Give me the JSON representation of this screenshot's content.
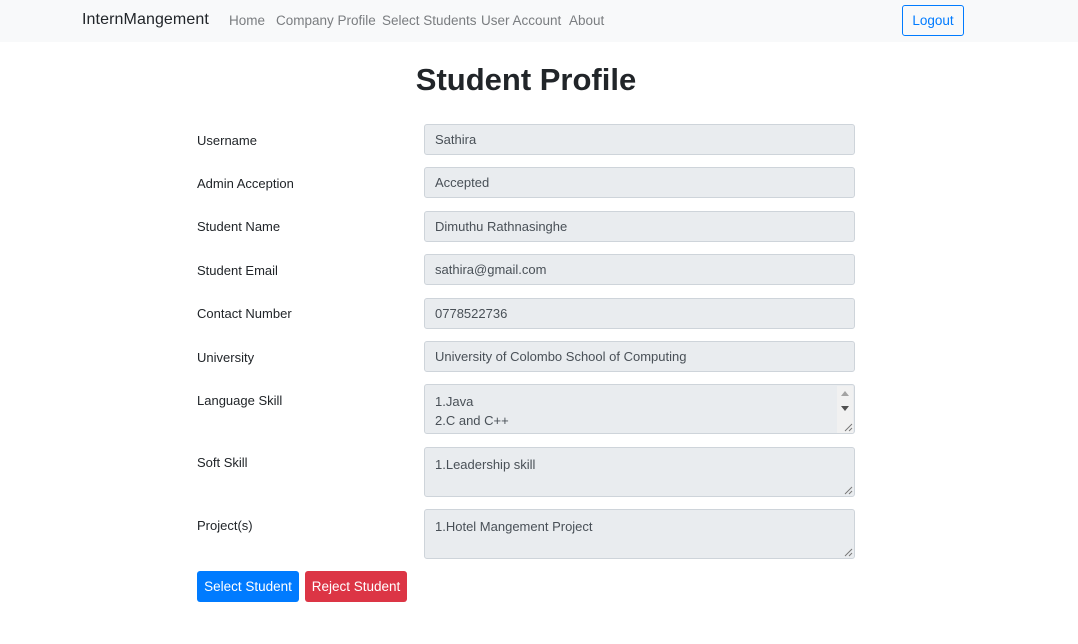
{
  "navbar": {
    "brand": "InternMangement",
    "links": [
      "Home",
      "Company Profile",
      "Select Students",
      "User Account",
      "About"
    ],
    "logout_label": "Logout"
  },
  "page": {
    "title": "Student Profile"
  },
  "fields": {
    "username": {
      "label": "Username",
      "value": "Sathira"
    },
    "admin_acception": {
      "label": "Admin Acception",
      "value": "Accepted"
    },
    "student_name": {
      "label": "Student Name",
      "value": "Dimuthu Rathnasinghe"
    },
    "student_email": {
      "label": "Student Email",
      "value": "sathira@gmail.com"
    },
    "contact_number": {
      "label": "Contact Number",
      "value": "0778522736"
    },
    "university": {
      "label": "University",
      "value": "University of Colombo School of Computing"
    },
    "language_skill": {
      "label": "Language Skill",
      "lines": [
        "1.Java",
        "2.C and C++"
      ]
    },
    "soft_skill": {
      "label": "Soft Skill",
      "lines": [
        "1.Leadership skill"
      ]
    },
    "projects": {
      "label": "Project(s)",
      "lines": [
        "1.Hotel Mangement Project"
      ]
    }
  },
  "actions": {
    "select_label": "Select Student",
    "reject_label": "Reject Student"
  },
  "colors": {
    "primary": "#007bff",
    "danger": "#dc3545",
    "navbar_bg": "#f8f9fa",
    "input_bg": "#e9ecef"
  }
}
